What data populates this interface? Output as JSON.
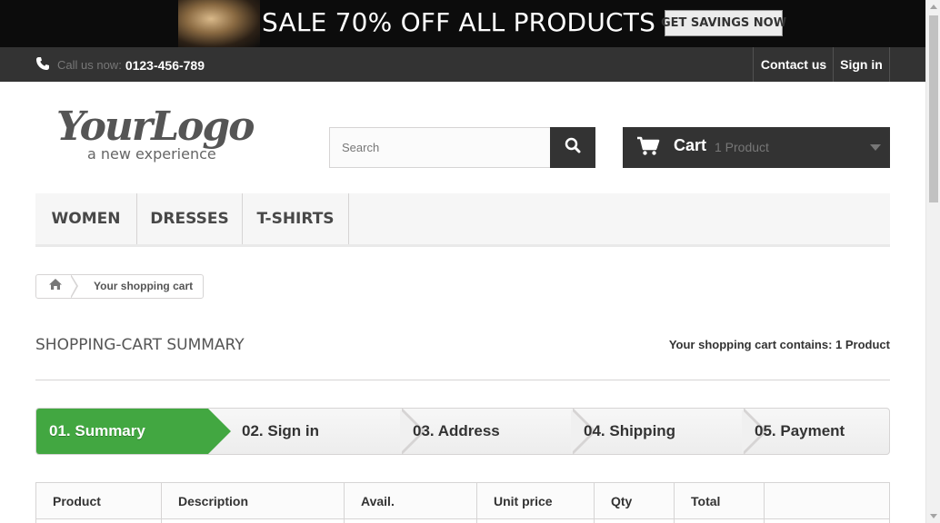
{
  "banner": {
    "headline": "SALE 70% OFF ALL PRODUCTS",
    "button_label": "GET SAVINGS NOW"
  },
  "topnav": {
    "call_label": "Call us now:",
    "phone": "0123-456-789",
    "contact_label": "Contact us",
    "signin_label": "Sign in"
  },
  "header": {
    "logo_main": "YourLogo",
    "logo_tagline": "a new experience",
    "search_placeholder": "Search",
    "cart_label": "Cart",
    "cart_qty": "1 Product"
  },
  "menu": {
    "items": [
      {
        "label": "WOMEN"
      },
      {
        "label": "DRESSES"
      },
      {
        "label": "T-SHIRTS"
      }
    ]
  },
  "breadcrumb": {
    "current": "Your shopping cart"
  },
  "page": {
    "heading": "SHOPPING-CART SUMMARY",
    "contains_text": "Your shopping cart contains: 1 Product"
  },
  "steps": [
    {
      "label": "01. Summary",
      "active": true
    },
    {
      "label": "02. Sign in",
      "active": false
    },
    {
      "label": "03. Address",
      "active": false
    },
    {
      "label": "04. Shipping",
      "active": false
    },
    {
      "label": "05. Payment",
      "active": false
    }
  ],
  "table": {
    "headers": [
      "Product",
      "Description",
      "Avail.",
      "Unit price",
      "Qty",
      "Total",
      ""
    ]
  },
  "colors": {
    "dark": "#333333",
    "accent_green": "#42a741",
    "border": "#d6d4d4"
  }
}
